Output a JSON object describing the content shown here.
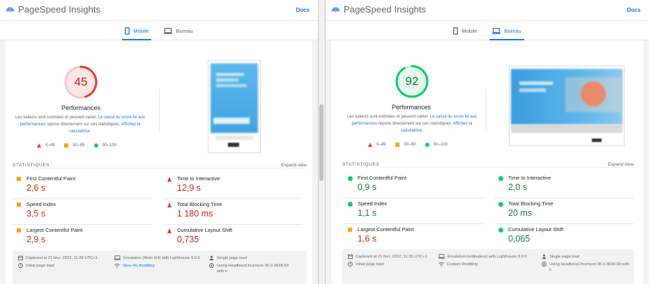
{
  "colors": {
    "fail": "#e53935",
    "average": "#ffa400",
    "pass": "#0cce6b",
    "accent": "#1a73e8"
  },
  "left": {
    "brand": "PageSpeed Insights",
    "docs": "Docs",
    "tabs": {
      "mobile": "Mobile",
      "desktop": "Bureau"
    },
    "active_tab": "mobile",
    "score": {
      "value": "45",
      "status": "fail",
      "fraction": 0.45
    },
    "perf_title": "Performances",
    "desc": {
      "p1": "Les valeurs sont estimées et peuvent varier. ",
      "link1a": "Le calcul du score lié aux",
      "link1b": "performances",
      "p2": " repose directement sur ces statistiques. ",
      "link2a": "Affichez la",
      "link2b": "calculatrice."
    },
    "legend": [
      "0–49",
      "50–89",
      "90–100"
    ],
    "stats_title": "STATISTIQUES",
    "expand": "Expand view",
    "metrics": [
      {
        "label": "First Contentful Paint",
        "value": "2,6 s",
        "status": "average"
      },
      {
        "label": "Time to Interactive",
        "value": "12,9 s",
        "status": "fail"
      },
      {
        "label": "Speed Index",
        "value": "3,5 s",
        "status": "average"
      },
      {
        "label": "Total Blocking Time",
        "value": "1 180 ms",
        "status": "fail"
      },
      {
        "label": "Largest Contentful Paint",
        "value": "2,9 s",
        "status": "average"
      },
      {
        "label": "Cumulative Layout Shift",
        "value": "0,735",
        "status": "fail"
      }
    ],
    "footer": {
      "captured": "Captured at 21 févr. 2022, 11:28 UTC+1",
      "emulation": "Émulation (Moto G4) with Lighthouse 9.0.0",
      "single": "Single page load",
      "initial": "Initial page load",
      "throttle": "Slow 4G throttling",
      "browser_a": "Using HeadlessChromium 95.0.4638.69",
      "browser_b": "with lr"
    }
  },
  "right": {
    "brand": "PageSpeed Insights",
    "docs": "Docs",
    "tabs": {
      "mobile": "Mobile",
      "desktop": "Bureau"
    },
    "active_tab": "desktop",
    "score": {
      "value": "92",
      "status": "pass",
      "fraction": 0.92
    },
    "perf_title": "Performances",
    "desc": {
      "p1": "Les valeurs sont estimées et peuvent varier. ",
      "link1a": "Le calcul du score lié aux",
      "link1b": "performances",
      "p2": " repose directement sur ces statistiques. ",
      "link2a": "Affichez la",
      "link2b": "calculatrice."
    },
    "legend": [
      "0–49",
      "50–89",
      "90–100"
    ],
    "stats_title": "STATISTIQUES",
    "expand": "Expand view",
    "metrics": [
      {
        "label": "First Contentful Paint",
        "value": "0,9 s",
        "status": "pass"
      },
      {
        "label": "Time to Interactive",
        "value": "2,0 s",
        "status": "pass"
      },
      {
        "label": "Speed Index",
        "value": "1,1 s",
        "status": "pass"
      },
      {
        "label": "Total Blocking Time",
        "value": "20 ms",
        "status": "pass"
      },
      {
        "label": "Largest Contentful Paint",
        "value": "1,6 s",
        "status": "average"
      },
      {
        "label": "Cumulative Layout Shift",
        "value": "0,065",
        "status": "pass"
      }
    ],
    "footer": {
      "captured": "Captured at 21 févr. 2022, 11:35 UTC+1",
      "emulation": "Émulation (ordinateur) with Lighthouse 9.0.0",
      "single": "Single page load",
      "initial": "Initial page load",
      "throttle": "Custom throttling",
      "browser_a": "Using HeadlessChromium 95.0.4638.69 with",
      "browser_b": "lr"
    }
  }
}
